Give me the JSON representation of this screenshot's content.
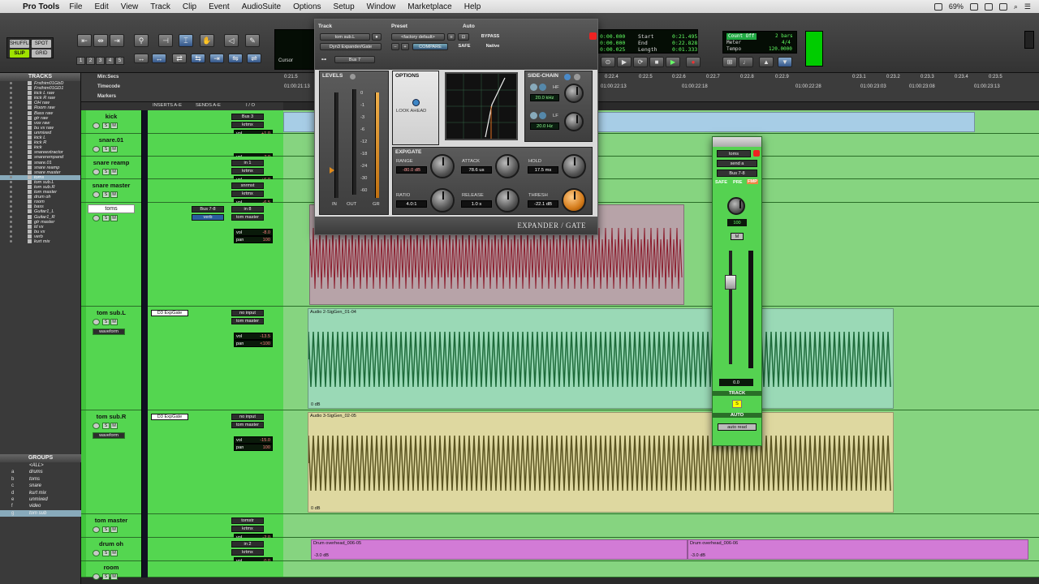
{
  "menubar": {
    "app": "Pro Tools",
    "items": [
      "File",
      "Edit",
      "View",
      "Track",
      "Clip",
      "Event",
      "AudioSuite",
      "Options",
      "Setup",
      "Window",
      "Marketplace",
      "Help"
    ],
    "battery": "69%"
  },
  "toolbar": {
    "modes": [
      "SHUFFLE",
      "SPOT",
      "SLIP",
      "GRID"
    ],
    "numbers": [
      "1",
      "2",
      "3",
      "4",
      "5"
    ],
    "cursor_label": "Cursor",
    "start_label": "Start",
    "end_label": "End",
    "length_label": "Length",
    "start": "0:21.495",
    "end": "0:22.828",
    "length": "0:01.333",
    "nudge1": "0:00.000",
    "nudge2": "0:00.000",
    "nudge3": "0:00.025",
    "count_off": "Count Off",
    "bars": "2 bars",
    "meter_label": "Meter",
    "meter": "4/4",
    "tempo_label": "Tempo",
    "tempo": "120.0000"
  },
  "tracks_panel": {
    "title": "TRACKS",
    "tracks": [
      "Frsthim01GbD",
      "Frsthim01GD1",
      "kick L raw",
      "kick R raw",
      "OH raw",
      "Room raw",
      "Bass raw",
      "gtr raw",
      "vox raw",
      "bu vx raw",
      "unmixed",
      "kick L",
      "kick R",
      "kick",
      "snareextractor",
      "snarerempand",
      "snare.01",
      "snare reamp",
      "snare master",
      "toms",
      "tom sub.L",
      "tom sub.R",
      "tom master",
      "drum oh",
      "room",
      "bass",
      "Guitar1_L",
      "Guitar1_R",
      "gtr master",
      "ld vx",
      "bu vx",
      "verb",
      "kurt mix"
    ]
  },
  "groups_panel": {
    "title": "GROUPS",
    "groups": [
      {
        "letter": "",
        "name": "<ALL>"
      },
      {
        "letter": "a",
        "name": "drums"
      },
      {
        "letter": "b",
        "name": "toms"
      },
      {
        "letter": "c",
        "name": "snare"
      },
      {
        "letter": "d",
        "name": "kurt mix"
      },
      {
        "letter": "e",
        "name": "unmixed"
      },
      {
        "letter": "f",
        "name": "video"
      },
      {
        "letter": "g",
        "name": "tom sub"
      }
    ]
  },
  "ruler": {
    "rows": [
      "Min:Secs",
      "Timecode",
      "Markers"
    ],
    "ticks": [
      "0:21.5",
      "0:22.4",
      "0:22.5",
      "0:22.6",
      "0:22.7",
      "0:22.8",
      "0:22.9",
      "0:23.1",
      "0:23.2",
      "0:23.3",
      "0:23.4",
      "0:23.5"
    ],
    "tc_ticks": [
      "01:00:21:13",
      "01:00:22:13",
      "01:00:22:18",
      "01:00:22:28",
      "01:00:23:03",
      "01:00:23:08",
      "01:00:23:13"
    ]
  },
  "mix_headers": [
    "INSERTS A-E",
    "SENDS A-E",
    "I / O"
  ],
  "tracks": [
    {
      "name": "kick",
      "io1": "Bus 3",
      "io2": "krtmx",
      "vol": "+1.0",
      "pan": "0"
    },
    {
      "name": "snare.01",
      "io1": "",
      "io2": "",
      "vol": "-7.0",
      "pan": ""
    },
    {
      "name": "snare reamp",
      "io1": "in 1",
      "io2": "krtmx",
      "vol": "+6.0",
      "pan": ""
    },
    {
      "name": "snare master",
      "io1": "snrmst",
      "io2": "krtmx",
      "vol": "-6.5",
      "pan": "0"
    },
    {
      "name": "toms",
      "send": "Bus 7-8",
      "send2": "verb",
      "io1": "in 8",
      "io2": "tom master",
      "vol": "-8.0",
      "pan": "100"
    },
    {
      "name": "tom sub.L",
      "insert": "D3 ExpGate",
      "io1": "no input",
      "io2": "tom master",
      "vol": "-13.5",
      "pan": "<100",
      "view": "waveform"
    },
    {
      "name": "tom sub.R",
      "insert": "D3 ExpGate",
      "io1": "no input",
      "io2": "tom master",
      "vol": "-15.0",
      "pan": "100",
      "view": "waveform"
    },
    {
      "name": "tom master",
      "io1": "tomstr",
      "io2": "krtmx",
      "vol": "-2.0",
      "pan": "0"
    },
    {
      "name": "drum oh",
      "io1": "in 2",
      "io2": "krtmx",
      "vol": "0.0",
      "pan": "0"
    },
    {
      "name": "room",
      "io1": "",
      "io2": "",
      "vol": "",
      "pan": ""
    }
  ],
  "regions": {
    "sig1": "Audio 2-SigGen_01-04",
    "sig2": "Audio 3-SigGen_02-05",
    "drum1": "Drum overhead_006-05",
    "drum2": "Drum overhead_006-06",
    "gain0": "0 dB",
    "gain_neg": "-3.0 dB"
  },
  "plugin": {
    "track_label": "Track",
    "preset_label": "Preset",
    "auto_label": "Auto",
    "track_name": "tom sub.L",
    "plugin_name": "Dyn3 Expander/Gate",
    "preset_name": "<factory default>",
    "compare": "COMPARE",
    "bypass": "BYPASS",
    "safe": "SAFE",
    "native": "Native",
    "bus": "Bus 7",
    "levels": "LEVELS",
    "options": "OPTIONS",
    "look_ahead": "LOOK AHEAD",
    "sidechain": "SIDE-CHAIN",
    "hf_label": "HF",
    "lf_label": "LF",
    "hf": "20.0 kHz",
    "lf": "20.0 Hz",
    "expgate": "EXP/GATE",
    "meter_labels": [
      "IN",
      "OUT",
      "GR"
    ],
    "scale": [
      "0",
      "-1",
      "-3",
      "-6",
      "-12",
      "-18",
      "-24",
      "-30",
      "-60"
    ],
    "range_label": "RANGE",
    "range": "-80.0 dB",
    "attack_label": "ATTACK",
    "attack": "78.6 us",
    "hold_label": "HOLD",
    "hold": "17.5 ms",
    "ratio_label": "RATIO",
    "ratio": "4.0:1",
    "release_label": "RELEASE",
    "release": "1.0 s",
    "thresh_label": "THRESH",
    "thresh": "-22.1 dB",
    "footer": "EXPANDER / GATE"
  },
  "output_window": {
    "track": "toms",
    "send": "send a",
    "bus": "Bus 7-8",
    "safe": "SAFE",
    "pre": "PRE",
    "fmp": "FMP",
    "pan_val": "100",
    "mute": "M",
    "fader_val": "0.0",
    "track_label": "TRACK",
    "auto_label": "AUTO",
    "auto_mode": "auto read"
  },
  "colors": {
    "track_green": "#54d650",
    "region_blue": "#a7cde6",
    "region_teal": "#9ad9b6",
    "region_yellow": "#ded8a0",
    "region_pink": "#d27bd6"
  }
}
